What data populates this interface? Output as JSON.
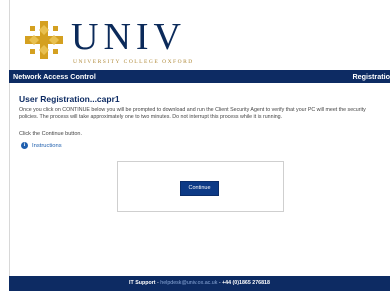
{
  "logo": {
    "wordmark": "UNIV",
    "subtitle": "UNIVERSITY COLLEGE OXFORD"
  },
  "navbar": {
    "title": "Network Access Control",
    "right_label": "Registratio"
  },
  "content": {
    "heading": "User Registration...capr1",
    "paragraph": "Once you click on CONTINUE below you will be prompted to download and run the Client Security Agent to verify that your PC will meet the security policies. The process will take approximately one to two minutes. Do not interrupt this process while it is running.",
    "click_text": "Click the Continue button.",
    "instructions_link": "Instructions",
    "continue_label": "Continue"
  },
  "footer": {
    "support_label": "IT Support",
    "separator1": " - ",
    "email": "helpdesk@univ.ox.ac.uk",
    "separator2": " - ",
    "phone": "+44 (0)1865 276818"
  },
  "colors": {
    "navy": "#0d2b63",
    "gold": "#d4a020",
    "link": "#1f5fae"
  }
}
